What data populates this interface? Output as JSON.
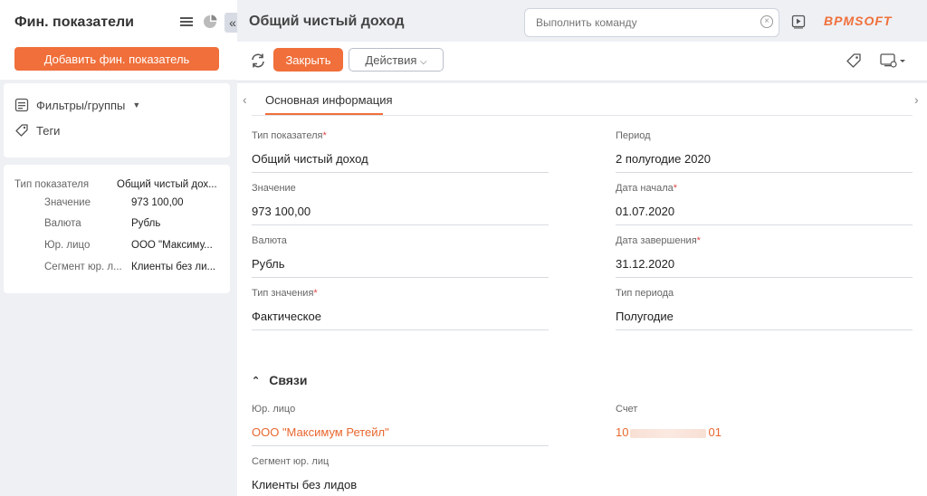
{
  "section": {
    "title": "Фин. показатели"
  },
  "left": {
    "add_button": "Добавить фин. показатель",
    "filters_label": "Фильтры/группы",
    "tags_label": "Теги",
    "summary": [
      {
        "label": "Тип показателя",
        "value": "Общий чистый дох..."
      },
      {
        "label": "Значение",
        "value": "973 100,00"
      },
      {
        "label": "Валюта",
        "value": "Рубль"
      },
      {
        "label": "Юр. лицо",
        "value": "ООО \"Максиму..."
      },
      {
        "label": "Сегмент юр. л...",
        "value": "Клиенты без ли..."
      }
    ]
  },
  "header": {
    "page_title": "Общий чистый доход",
    "command_placeholder": "Выполнить команду",
    "logo": "BPMSOFT"
  },
  "toolbar": {
    "close_label": "Закрыть",
    "actions_label": "Действия"
  },
  "tabs": [
    {
      "label": "Основная информация",
      "active": true
    }
  ],
  "fields_left": [
    {
      "label": "Тип показателя",
      "required": "*",
      "value": "Общий чистый доход"
    },
    {
      "label": "Значение",
      "required": "",
      "value": "973 100,00"
    },
    {
      "label": "Валюта",
      "required": "",
      "value": "Рубль"
    },
    {
      "label": "Тип значения",
      "required": "*",
      "value": "Фактическое"
    }
  ],
  "fields_right": [
    {
      "label": "Период",
      "required": "",
      "value": "2 полугодие 2020"
    },
    {
      "label": "Дата начала",
      "required": "*",
      "value": "01.07.2020"
    },
    {
      "label": "Дата завершения",
      "required": "*",
      "value": "31.12.2020"
    },
    {
      "label": "Тип периода",
      "required": "",
      "value": "Полугодие"
    }
  ],
  "links_section": {
    "title": "Связи",
    "legal_entity": {
      "label": "Юр. лицо",
      "value": "ООО \"Максимум Ретейл\""
    },
    "account": {
      "label": "Счет",
      "value_start": "10",
      "value_end": "01"
    },
    "segment": {
      "label": "Сегмент юр. лиц",
      "value": "Клиенты без лидов"
    }
  },
  "colors": {
    "accent": "#f06f3a",
    "link": "#e8672f",
    "required": "#e04a4a"
  }
}
